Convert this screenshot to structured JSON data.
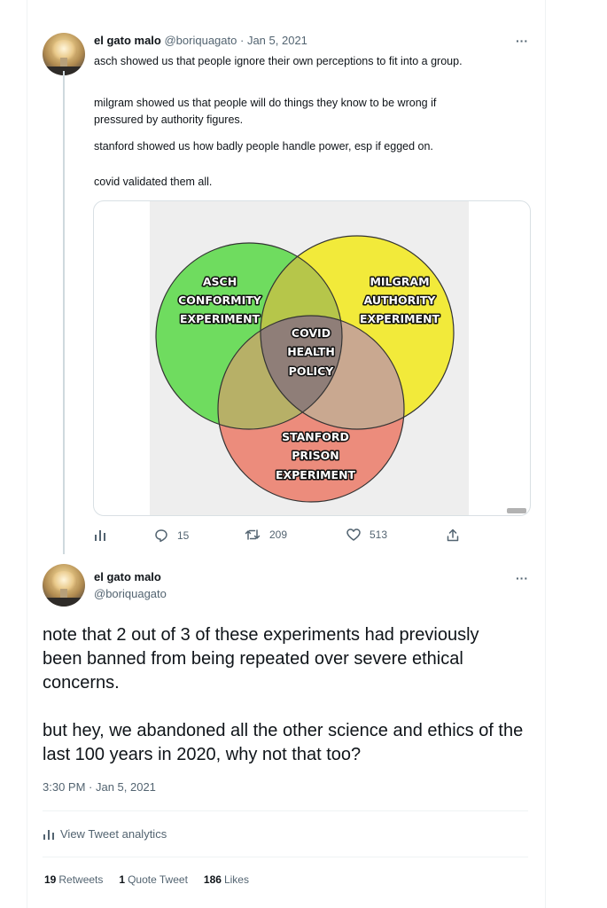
{
  "tweet1": {
    "display_name": "el gato malo",
    "handle": "@boriquagato",
    "separator": "·",
    "date": "Jan 5, 2021",
    "more": "···",
    "paragraphs": [
      "asch showed us that people ignore their own perceptions to fit into a group.",
      "milgram showed us that people will do things they know to be wrong if pressured by authority figures.",
      "stanford showed us how badly people handle power, esp if egged on.",
      "covid validated them all."
    ],
    "image": {
      "circle_asch": [
        "ASCH",
        "CONFORMITY",
        "EXPERIMENT"
      ],
      "circle_milgram": [
        "MILGRAM",
        "AUTHORITY",
        "EXPERIMENT"
      ],
      "circle_stanford": [
        "STANFORD",
        "PRISON",
        "EXPERIMENT"
      ],
      "center": [
        "COVID",
        "HEALTH",
        "POLICY"
      ],
      "colors": {
        "asch": "#6fdc5f",
        "milgram": "#f2ea3a",
        "stanford": "#ec8c7c",
        "asch_milgram": "#b6c64a",
        "asch_stanford": "#b7b067",
        "milgram_stanford": "#c9a890",
        "center": "#8f7e78"
      }
    },
    "actions": {
      "analytics_icon": "bar-chart-icon",
      "replies": "15",
      "retweets": "209",
      "likes": "513",
      "share_icon": "share-icon"
    }
  },
  "tweet2": {
    "display_name": "el gato malo",
    "handle": "@boriquagato",
    "more": "···",
    "paragraph1": "note that 2 out of 3 of these experiments had previously been banned from being repeated over severe ethical concerns.",
    "paragraph2": "but hey, we abandoned all the other science and ethics of the last 100 years in 2020, why not that too?",
    "timestamp": "3:30 PM · Jan 5, 2021",
    "analytics_label": "View Tweet analytics",
    "stats": {
      "retweets_count": "19",
      "retweets_label": "Retweets",
      "quotes_count": "1",
      "quotes_label": "Quote Tweet",
      "likes_count": "186",
      "likes_label": "Likes"
    }
  }
}
